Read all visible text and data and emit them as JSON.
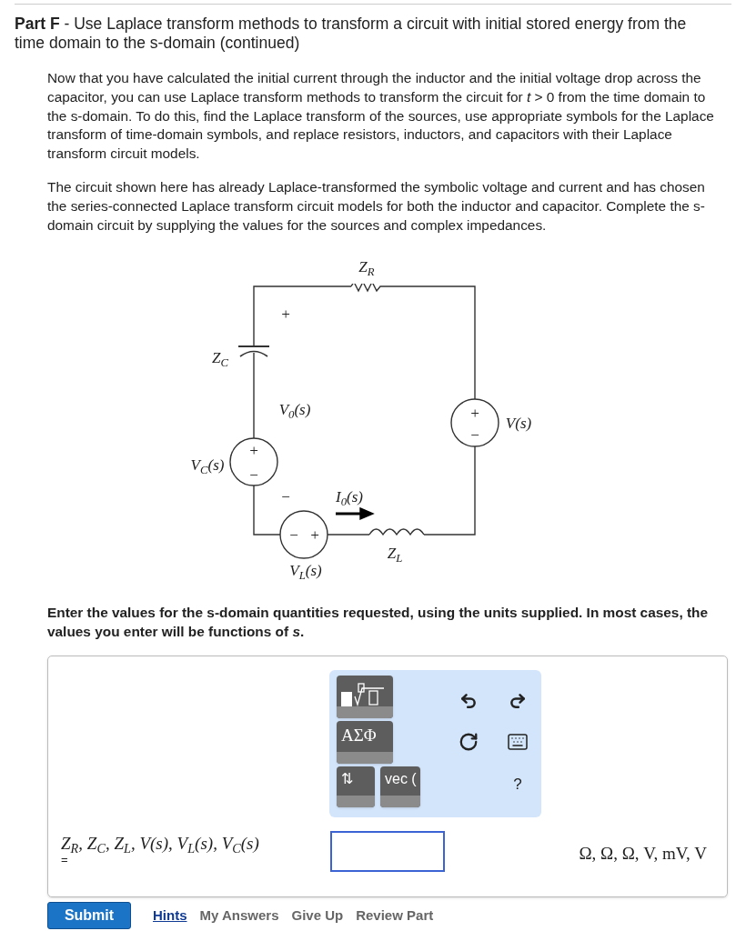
{
  "part": {
    "label": "Part F",
    "separator": "-",
    "title": "Use Laplace transform methods to transform a circuit with initial stored energy from the time domain to the s-domain (continued)"
  },
  "paragraphs": [
    "Now that you have calculated the initial current through the inductor and the initial voltage drop across the capacitor, you can use Laplace transform methods to transform the circuit for *t* > 0 from the time domain to the s-domain. To do this, find the Laplace transform of the sources, use appropriate symbols for the Laplace transform of time-domain symbols, and replace resistors, inductors, and capacitors with their Laplace transform circuit models.",
    "The circuit shown here has already Laplace-transformed the symbolic voltage and current and has chosen the series-connected Laplace transform circuit models for both the inductor and capacitor. Complete the s-domain circuit by supplying the values for the sources and complex impedances."
  ],
  "circuit": {
    "labels": [
      "Z$_{R}$",
      "Z$_{C}$",
      "+",
      "V$_{0}$(s)",
      "V$_{C}$(s)",
      "+",
      "−",
      "−",
      "I$_{0}$(s)",
      "−",
      "+",
      "Z$_{L}$",
      "V$_{L}$(s)",
      "+",
      "−",
      "V(s)"
    ]
  },
  "instruction": "Enter the values for the s-domain quantities requested, using the units supplied. In most cases, the values you enter will be functions of *s*.",
  "toolbar": {
    "greek": "ΑΣΦ",
    "arrows": "⇅",
    "vec": "vec (",
    "help": "?"
  },
  "answer": {
    "prompt": "Z$_{R}$, Z$_{C}$, Z$_{L}$, V(s), V$_{L}$(s), V$_{C}$(s)",
    "equals": "=",
    "units": "Ω, Ω, Ω, V, mV, V"
  },
  "actions": {
    "submit": "Submit",
    "links": [
      {
        "label": "Hints",
        "disabled": false
      },
      {
        "label": "My Answers",
        "disabled": true
      },
      {
        "label": "Give Up",
        "disabled": true
      },
      {
        "label": "Review Part",
        "disabled": true
      }
    ]
  }
}
